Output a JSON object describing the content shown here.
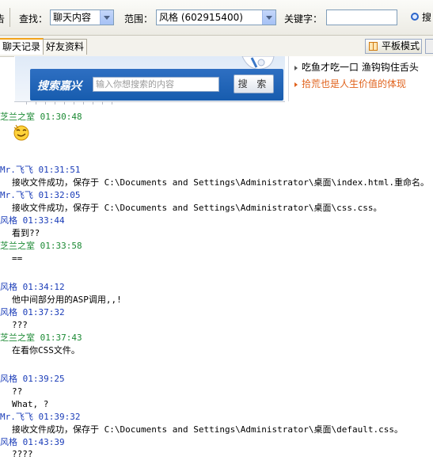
{
  "toolbar": {
    "left_fragment": "告",
    "find_label": "查找：",
    "find_value": "聊天内容",
    "scope_label": "范围：",
    "scope_value": "风格 (602915400)",
    "keyword_label": "关键字：",
    "keyword_value": "",
    "search_label": "搜"
  },
  "tabs": [
    {
      "label": "聊天记录",
      "active": true
    },
    {
      "label": "好友资料",
      "active": false
    }
  ],
  "mode_button": {
    "label": "平板模式"
  },
  "ad": {
    "title": "搜索嘉兴",
    "input_placeholder": "输入你想搜索的内容",
    "button_label": "搜 索",
    "links": [
      {
        "text": "吃鱼才吃一口 渔钩钩住舌头",
        "style": "normal"
      },
      {
        "text": "拾荒也是人生价值的体现",
        "style": "orange"
      }
    ]
  },
  "colors": {
    "green_sender": "#1c8a34",
    "blue_sender": "#1a3cb8",
    "ad_blue": "#175cae",
    "ad_orange": "#e0621c"
  },
  "messages": [
    {
      "sender": "芝兰之室",
      "time": "01:30:48",
      "color": "green",
      "lines": [],
      "emoticon": "grin-face-icon"
    },
    {
      "sender": "Mr.飞飞",
      "time": "01:31:51",
      "color": "blue",
      "lines": [
        "接收文件成功，保存于 C:\\Documents and Settings\\Administrator\\桌面\\index.html.重命名。"
      ]
    },
    {
      "sender": "Mr.飞飞",
      "time": "01:32:05",
      "color": "blue",
      "lines": [
        "接收文件成功，保存于 C:\\Documents and Settings\\Administrator\\桌面\\css.css。"
      ]
    },
    {
      "sender": "风格",
      "time": "01:33:44",
      "color": "blue",
      "lines": [
        "看到??"
      ]
    },
    {
      "sender": "芝兰之室",
      "time": "01:33:58",
      "color": "green",
      "lines": [
        "=="
      ]
    },
    {
      "sender": "风格",
      "time": "01:34:12",
      "color": "blue",
      "lines": [
        "他中间部分用的ASP调用,,!"
      ]
    },
    {
      "sender": "风格",
      "time": "01:37:32",
      "color": "blue",
      "lines": [
        "???"
      ]
    },
    {
      "sender": "芝兰之室",
      "time": "01:37:43",
      "color": "green",
      "lines": [
        "在看你CSS文件。"
      ]
    },
    {
      "sender": "风格",
      "time": "01:39:25",
      "color": "blue",
      "lines": [
        "??",
        "What, ?"
      ]
    },
    {
      "sender": "Mr.飞飞",
      "time": "01:39:32",
      "color": "blue",
      "lines": [
        "接收文件成功，保存于 C:\\Documents and Settings\\Administrator\\桌面\\default.css。"
      ]
    },
    {
      "sender": "风格",
      "time": "01:43:39",
      "color": "blue",
      "lines": [
        "????"
      ]
    }
  ]
}
